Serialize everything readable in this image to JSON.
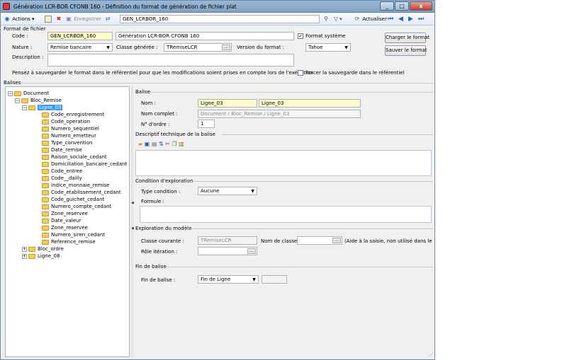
{
  "window": {
    "title": "Génération LCR-BOR CFONB 160  -  Définition du format de génération de fichier plat",
    "minimize": "_",
    "maximize": "□",
    "close": "x"
  },
  "toolbar": {
    "actions_label": "Actions",
    "save_label": "Enregistrer",
    "search_value": "GEN_LCRBOR_160",
    "refresh_label": "Actualiser"
  },
  "format": {
    "section_title": "Format de fichier",
    "code_label": "Code :",
    "code_value": "GEN_LCRBOR_160",
    "name_value": "Génération LCR-BOR CFONB 160",
    "system_format_label": "Format système",
    "nature_label": "Nature :",
    "nature_value": "Remise bancaire",
    "generated_class_label": "Classe générée :",
    "generated_class_value": "TRemiseLCR",
    "version_label": "Version du format :",
    "version_value": "Tahoe",
    "description_label": "Description :",
    "load_button": "Charger le format",
    "save_format_button": "Sauver le format",
    "reminder_text": "Pensez à sauvegarder le format dans le référentiel pour que les modifications soient prises en compte lors de l'exécution",
    "force_save_label": "Forcer la sauvegarde dans le référentiel"
  },
  "balises_title": "Balises",
  "tree": {
    "root": "Document",
    "bloc_remise": "Bloc_Remise",
    "ligne_03": "Ligne_03",
    "fields": [
      "Code_enregistrement",
      "Code_operation",
      "Numero_sequentiel",
      "Numero_emetteur",
      "Type_convention",
      "Date_remise",
      "Raison_sociale_cedant",
      "Domiciliation_bancaire_cedant",
      "Code_entree",
      "Code__dailly",
      "Indice_monnaie_remise",
      "Code_etablissement_cedant",
      "Code_guichet_cedant",
      "Numero_compte_cedant",
      "Zone_reservee",
      "Date_valeur",
      "Zone_reservee",
      "Numero_siren_cedant",
      "Reference_remise"
    ],
    "bloc_ordre": "Bloc_ordre",
    "ligne_08": "Ligne_08"
  },
  "balise": {
    "section_title": "Balise",
    "nom_label": "Nom :",
    "nom_value1": "Ligne_03",
    "nom_value2": "Ligne_03",
    "nom_complet_label": "Nom complet :",
    "nom_complet_value": "Document / Bloc_Remise / Ligne_03",
    "ordre_label": "N° d'ordre :",
    "ordre_value": "1"
  },
  "descriptif": {
    "section_title": "Descriptif technique de la balise"
  },
  "condition": {
    "section_title": "Condition d'exploration",
    "type_label": "Type condition :",
    "type_value": "Aucune",
    "formule_label": "Formule :"
  },
  "exploration": {
    "section_title": "Exploration du modèle",
    "classe_label": "Classe courante :",
    "classe_value": "TRemiseLCR",
    "nom_classe_label": "Nom de classe :",
    "aide_text": "(Aide à la saisie, non utilisé dans le proces",
    "role_label": "Rôle itération :"
  },
  "fin": {
    "section_title": "Fin de balise",
    "label": "Fin de balise :",
    "value": "Fin de Ligne"
  }
}
